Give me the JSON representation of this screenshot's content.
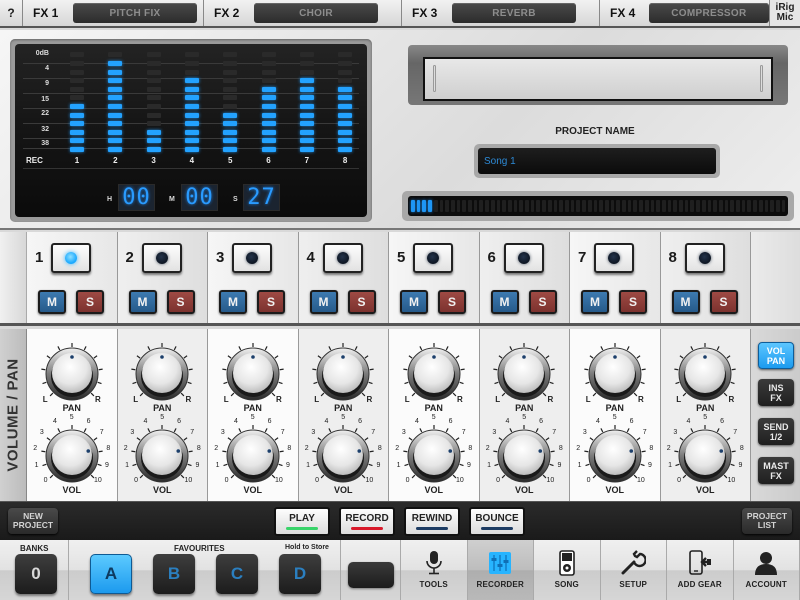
{
  "fx_bar": {
    "help_label": "?",
    "slots": [
      {
        "label": "FX 1",
        "effect": "PITCH FIX"
      },
      {
        "label": "FX 2",
        "effect": "CHOIR"
      },
      {
        "label": "FX 3",
        "effect": "REVERB"
      },
      {
        "label": "FX 4",
        "effect": "COMPRESSOR"
      }
    ],
    "device_line1": "iRig",
    "device_line2": "Mic"
  },
  "meter": {
    "db_scale": [
      "0dB",
      "4",
      "9",
      "15",
      "22",
      "32",
      "38"
    ],
    "rec_label": "REC",
    "segments_per_channel": 12,
    "channels": [
      {
        "label": "1",
        "lit_segments": 6
      },
      {
        "label": "2",
        "lit_segments": 11
      },
      {
        "label": "3",
        "lit_segments": 3
      },
      {
        "label": "4",
        "lit_segments": 9
      },
      {
        "label": "5",
        "lit_segments": 5
      },
      {
        "label": "6",
        "lit_segments": 8
      },
      {
        "label": "7",
        "lit_segments": 9
      },
      {
        "label": "8",
        "lit_segments": 8
      }
    ],
    "time": {
      "h_label": "H",
      "hours": "00",
      "m_label": "M",
      "minutes": "00",
      "s_label": "S",
      "seconds": "27"
    }
  },
  "project": {
    "title": "PROJECT NAME",
    "name": "Song 1",
    "progress_lit_segments": 4,
    "progress_total_segments": 66
  },
  "channels": [
    {
      "number": "1",
      "armed": true,
      "mute_label": "M",
      "solo_label": "S",
      "pan": 0,
      "volume": 7.7
    },
    {
      "number": "2",
      "armed": false,
      "mute_label": "M",
      "solo_label": "S",
      "pan": 0,
      "volume": 7.7
    },
    {
      "number": "3",
      "armed": false,
      "mute_label": "M",
      "solo_label": "S",
      "pan": 0,
      "volume": 7.7
    },
    {
      "number": "4",
      "armed": false,
      "mute_label": "M",
      "solo_label": "S",
      "pan": 0,
      "volume": 7.7
    },
    {
      "number": "5",
      "armed": false,
      "mute_label": "M",
      "solo_label": "S",
      "pan": 0,
      "volume": 7.7
    },
    {
      "number": "6",
      "armed": false,
      "mute_label": "M",
      "solo_label": "S",
      "pan": 0,
      "volume": 7.7
    },
    {
      "number": "7",
      "armed": false,
      "mute_label": "M",
      "solo_label": "S",
      "pan": 0,
      "volume": 7.7
    },
    {
      "number": "8",
      "armed": false,
      "mute_label": "M",
      "solo_label": "S",
      "pan": 0,
      "volume": 7.7
    }
  ],
  "mixer": {
    "section_label": "VOLUME / PAN",
    "pan_label": "PAN",
    "pan_left": "L",
    "pan_right": "R",
    "vol_label": "VOL",
    "vol_scale": [
      "0",
      "1",
      "2",
      "3",
      "4",
      "5",
      "6",
      "7",
      "8",
      "9",
      "10"
    ],
    "side_buttons": [
      {
        "line1": "VOL",
        "line2": "PAN",
        "active": true
      },
      {
        "line1": "INS",
        "line2": "FX",
        "active": false
      },
      {
        "line1": "SEND",
        "line2": "1/2",
        "active": false
      },
      {
        "line1": "MAST",
        "line2": "FX",
        "active": false
      }
    ]
  },
  "transport": {
    "new_project_line1": "NEW",
    "new_project_line2": "PROJECT",
    "play": "PLAY",
    "record": "RECORD",
    "rewind": "REWIND",
    "bounce": "BOUNCE",
    "project_list_line1": "PROJECT",
    "project_list_line2": "LIST",
    "colors": {
      "play": "#39d46a",
      "record": "#d9192a",
      "rewind": "#1d3c63",
      "bounce": "#1d3c63"
    }
  },
  "bottom": {
    "banks_label": "BANKS",
    "bank_value": "0",
    "favourites_label": "FAVOURITES",
    "hold_hint": "Hold to Store",
    "favourites": [
      {
        "label": "A",
        "active": true
      },
      {
        "label": "B",
        "active": false
      },
      {
        "label": "C",
        "active": false
      },
      {
        "label": "D",
        "active": false
      }
    ],
    "nav": [
      {
        "label": "TOOLS",
        "icon": "microphone-icon",
        "active": false
      },
      {
        "label": "RECORDER",
        "icon": "mixer-faders-icon",
        "active": true
      },
      {
        "label": "SONG",
        "icon": "music-player-icon",
        "active": false
      },
      {
        "label": "SETUP",
        "icon": "wrench-icon",
        "active": false
      },
      {
        "label": "ADD GEAR",
        "icon": "add-device-icon",
        "active": false
      },
      {
        "label": "ACCOUNT",
        "icon": "user-icon",
        "active": false
      }
    ]
  },
  "colors": {
    "accent_blue": "#1e9bf0",
    "meter_blue": "#23a2ff",
    "mute_blue": "#2f6a9e",
    "solo_red": "#8c3d38"
  }
}
